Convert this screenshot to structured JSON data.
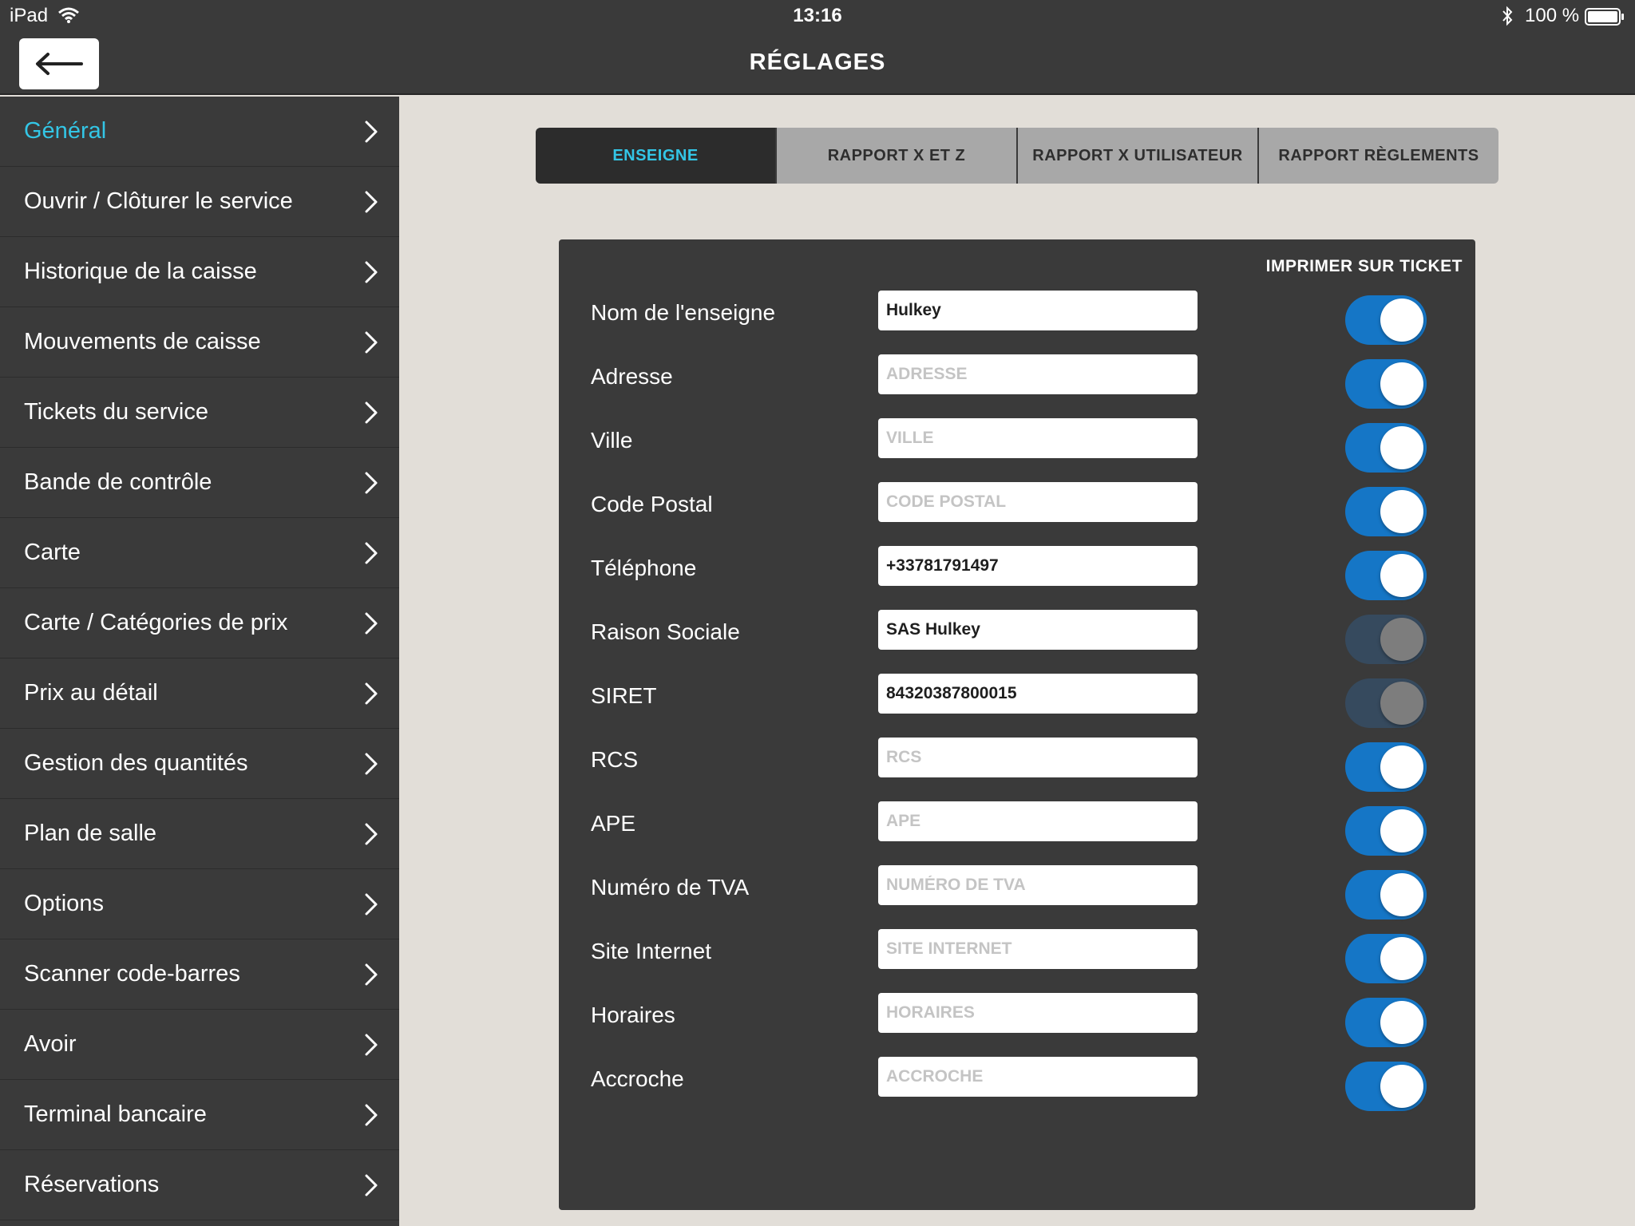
{
  "status_bar": {
    "device": "iPad",
    "time": "13:16",
    "battery": "100 %"
  },
  "header": {
    "title": "RÉGLAGES",
    "back_icon": "arrow-left-icon"
  },
  "sidebar": {
    "items": [
      {
        "label": "Général",
        "active": true
      },
      {
        "label": "Ouvrir / Clôturer le service"
      },
      {
        "label": "Historique de la caisse"
      },
      {
        "label": "Mouvements de caisse"
      },
      {
        "label": "Tickets du service"
      },
      {
        "label": "Bande de contrôle"
      },
      {
        "label": "Carte"
      },
      {
        "label": "Carte / Catégories de prix"
      },
      {
        "label": "Prix au détail"
      },
      {
        "label": "Gestion des quantités"
      },
      {
        "label": "Plan de salle"
      },
      {
        "label": "Options"
      },
      {
        "label": "Scanner code-barres"
      },
      {
        "label": "Avoir"
      },
      {
        "label": "Terminal bancaire"
      },
      {
        "label": "Réservations"
      }
    ]
  },
  "tabs": [
    {
      "label": "ENSEIGNE",
      "active": true
    },
    {
      "label": "RAPPORT X ET Z"
    },
    {
      "label": "RAPPORT X UTILISATEUR"
    },
    {
      "label": "RAPPORT RÈGLEMENTS"
    }
  ],
  "form": {
    "print_header": "IMPRIMER SUR TICKET",
    "fields": [
      {
        "label": "Nom de l'enseigne",
        "value": "Hulkey",
        "placeholder": "",
        "print": true
      },
      {
        "label": "Adresse",
        "value": "",
        "placeholder": "ADRESSE",
        "print": true
      },
      {
        "label": "Ville",
        "value": "",
        "placeholder": "VILLE",
        "print": true
      },
      {
        "label": "Code Postal",
        "value": "",
        "placeholder": "CODE POSTAL",
        "print": true
      },
      {
        "label": "Téléphone",
        "value": "+33781791497",
        "placeholder": "",
        "print": true
      },
      {
        "label": "Raison Sociale",
        "value": "SAS Hulkey",
        "placeholder": "",
        "print": false
      },
      {
        "label": "SIRET",
        "value": "84320387800015",
        "placeholder": "",
        "print": false
      },
      {
        "label": "RCS",
        "value": "",
        "placeholder": "RCS",
        "print": true
      },
      {
        "label": "APE",
        "value": "",
        "placeholder": "APE",
        "print": true
      },
      {
        "label": "Numéro de TVA",
        "value": "",
        "placeholder": "NUMÉRO DE TVA",
        "print": true
      },
      {
        "label": "Site Internet",
        "value": "",
        "placeholder": "SITE INTERNET",
        "print": true
      },
      {
        "label": "Horaires",
        "value": "",
        "placeholder": "HORAIRES",
        "print": true
      },
      {
        "label": "Accroche",
        "value": "",
        "placeholder": "ACCROCHE",
        "print": true
      }
    ]
  },
  "colors": {
    "accent": "#33c6e6",
    "toggle_on": "#1576c6",
    "toggle_off": "#364a5e",
    "bar": "#3a3a3a",
    "background": "#e2ded8"
  }
}
